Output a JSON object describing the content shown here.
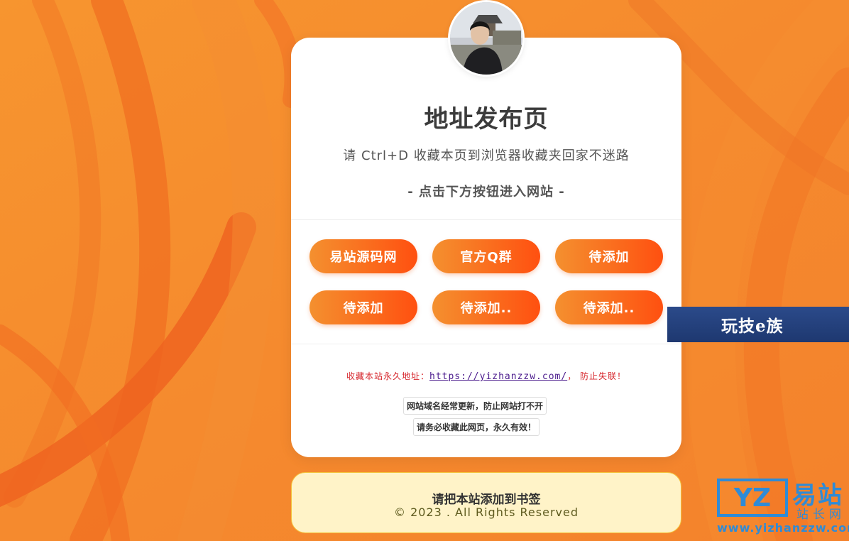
{
  "header": {
    "title": "地址发布页",
    "subtitle": "请 Ctrl+D 收藏本页到浏览器收藏夹回家不迷路",
    "hint": "- 点击下方按钮进入网站 -"
  },
  "buttons": [
    {
      "label": "易站源码网"
    },
    {
      "label": "官方Q群"
    },
    {
      "label": "待添加"
    },
    {
      "label": "待添加"
    },
    {
      "label": "待添加.."
    },
    {
      "label": "待添加.."
    }
  ],
  "permanent": {
    "prefix": "收藏本站永久地址：",
    "url": "https://yizhanzzw.com/",
    "suffix": "， 防止失联！"
  },
  "notes": {
    "line1": "网站域名经常更新，防止网站打不开",
    "line2": "请务必收藏此网页，永久有效！"
  },
  "footer": {
    "title": "请把本站添加到书签",
    "copyright": "© 2023 . All Rights Reserved"
  },
  "badge": {
    "label": "玩技e族"
  },
  "watermark": {
    "logo": "YZ",
    "name": "易站",
    "tagline": "站长网",
    "url": "www.yizhanzzw.com"
  },
  "colors": {
    "background": "#f58a2e",
    "button_start": "#f4902f",
    "button_end": "#ff5010",
    "link_red": "#d6262c",
    "footer_bg": "#fff3c8"
  }
}
